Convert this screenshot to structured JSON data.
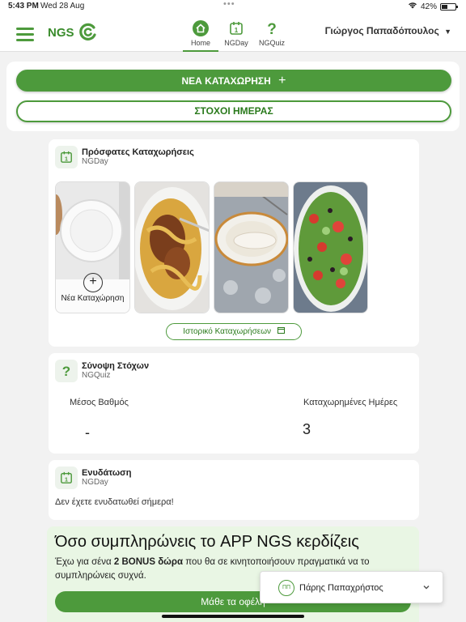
{
  "status_bar": {
    "time": "5:43 PM",
    "date": "Wed 28 Aug",
    "battery": "42%",
    "battery_level": 0.42
  },
  "header": {
    "brand": "NGS",
    "nav": [
      {
        "label": "Home",
        "icon": "home-icon"
      },
      {
        "label": "NGDay",
        "icon": "calendar-icon"
      },
      {
        "label": "NGQuiz",
        "icon": "question-icon"
      }
    ],
    "user_name": "Γιώργος Παπαδόπουλος"
  },
  "actions": {
    "new_entry": "ΝΕΑ ΚΑΤΑΧΩΡΗΣΗ",
    "daily_goals": "ΣΤΟΧΟΙ ΗΜΕΡΑΣ"
  },
  "recent": {
    "title": "Πρόσφατες Καταχωρήσεις",
    "subtitle": "NGDay",
    "new_entry_label": "Νέα Καταχώρηση",
    "history_button": "Ιστορικό Καταχωρήσεων"
  },
  "goals_summary": {
    "title": "Σύνοψη Στόχων",
    "subtitle": "NGQuiz",
    "avg_label": "Μέσος Βαθμός",
    "avg_value": "-",
    "days_label": "Καταχωρημένες Ημέρες",
    "days_value": "3"
  },
  "hydration": {
    "title": "Ενυδάτωση",
    "subtitle": "NGDay",
    "message": "Δεν έχετε ενυδατωθεί σήμερα!"
  },
  "promo": {
    "title": "Όσο συμπληρώνεις το APP NGS κερδίζεις",
    "text_before": "Έχω για σένα ",
    "text_bold": "2 BONUS δώρα",
    "text_after": " που θα σε κινητοποιήσουν πραγματικά να το συμπληρώνεις συχνά.",
    "button": "Μάθε τα οφέλη"
  },
  "chat": {
    "initials": "ΠΠ",
    "name": "Πάρης Παπαχρήστος"
  },
  "colors": {
    "accent": "#4d9a3c",
    "promo_bg": "#e9f6e4"
  }
}
